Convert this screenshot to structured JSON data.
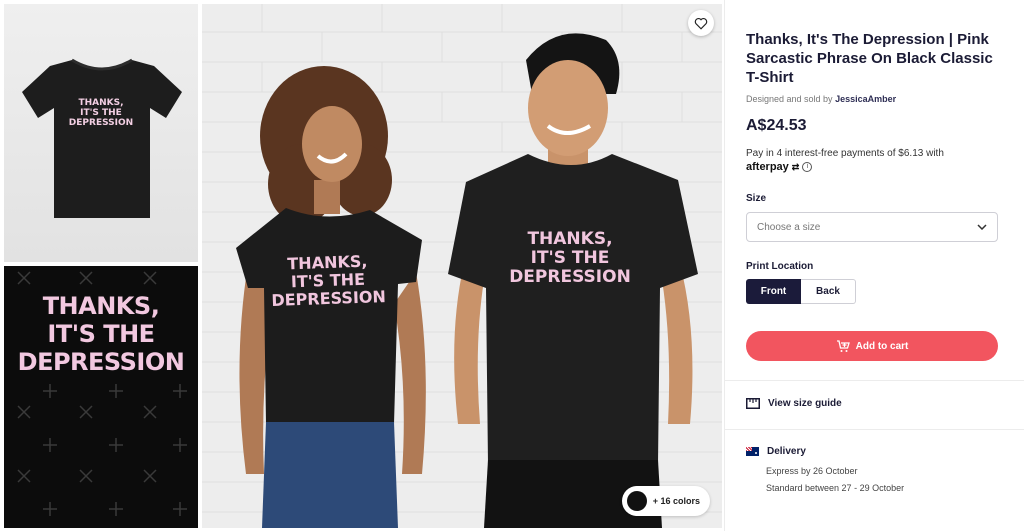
{
  "product": {
    "title": "Thanks, It's The Depression | Pink Sarcastic Phrase On Black Classic T-Shirt",
    "designed_by_prefix": "Designed and sold by",
    "artist": "JessicaAmber",
    "price": "A$24.53",
    "afterpay_text": "Pay in 4 interest-free payments of $6.13 with",
    "afterpay_brand": "afterpay",
    "afterpay_info": "i"
  },
  "print_text": {
    "line1": "THANKS,",
    "line2": "IT'S THE",
    "line3": "DEPRESSION"
  },
  "size": {
    "label": "Size",
    "placeholder": "Choose a size"
  },
  "print_location": {
    "label": "Print Location",
    "options": [
      "Front",
      "Back"
    ],
    "selected": "Front"
  },
  "actions": {
    "add_to_cart": "Add to cart",
    "view_size_guide": "View size guide"
  },
  "delivery": {
    "label": "Delivery",
    "express": "Express by 26 October",
    "standard": "Standard between 27 - 29 October"
  },
  "colors": {
    "label": "+ 16 colors",
    "selected_color": "#111111"
  },
  "theme": {
    "accent": "#f2555f",
    "navy": "#1b1b3a",
    "print_pink": "#f1c6de"
  }
}
